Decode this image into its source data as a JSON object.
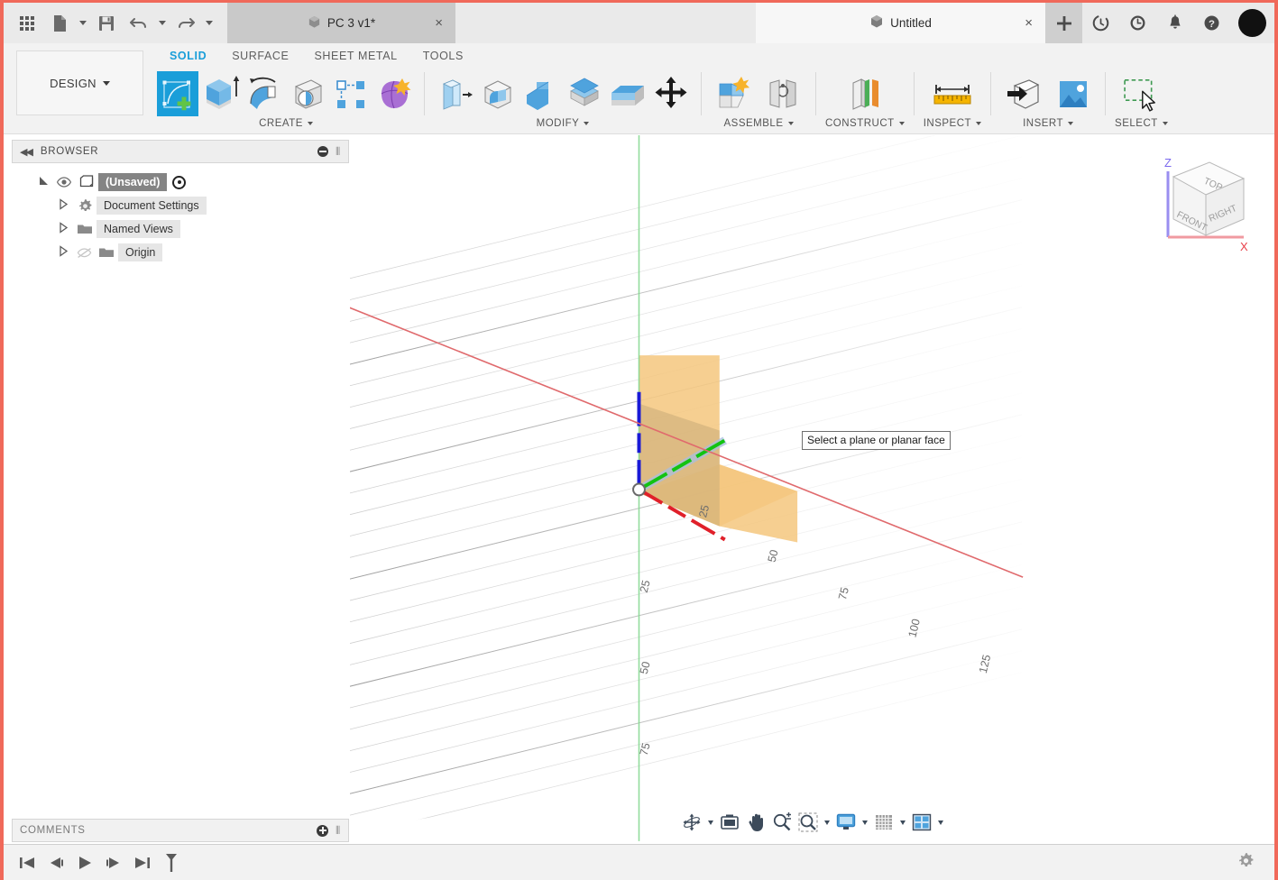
{
  "titlebar": {
    "apps_icon": "grid-apps-icon",
    "new_doc_icon": "new-document-icon",
    "save_icon": "save-icon",
    "undo_icon": "undo-icon",
    "redo_icon": "redo-icon",
    "tabs": [
      {
        "label": "PC 3 v1*",
        "icon": "cube-icon",
        "close": "×",
        "active": false
      },
      {
        "label": "Untitled",
        "icon": "cube-icon",
        "close": "×",
        "active": true
      }
    ],
    "new_tab_label": "+",
    "icons": [
      "job-status-icon",
      "recent-activity-icon",
      "notifications-bell-icon",
      "help-icon",
      "account-avatar"
    ]
  },
  "ribbon": {
    "workspace": "DESIGN",
    "tabs": [
      {
        "label": "SOLID",
        "active": true
      },
      {
        "label": "SURFACE",
        "active": false
      },
      {
        "label": "SHEET METAL",
        "active": false
      },
      {
        "label": "TOOLS",
        "active": false
      }
    ],
    "panels": [
      {
        "label": "CREATE",
        "has_dropdown": true,
        "tools": [
          "create-sketch-icon",
          "extrude-icon",
          "revolve-icon",
          "sweep-icon",
          "pattern-icon",
          "form-icon"
        ]
      },
      {
        "label": "MODIFY",
        "has_dropdown": true,
        "tools": [
          "press-pull-icon",
          "fillet-icon",
          "shell-icon",
          "combine-icon",
          "offset-face-icon",
          "move-copy-icon"
        ]
      },
      {
        "label": "ASSEMBLE",
        "has_dropdown": true,
        "tools": [
          "new-component-icon",
          "joint-icon"
        ]
      },
      {
        "label": "CONSTRUCT",
        "has_dropdown": true,
        "tools": [
          "offset-plane-icon"
        ]
      },
      {
        "label": "INSPECT",
        "has_dropdown": true,
        "tools": [
          "measure-icon"
        ]
      },
      {
        "label": "INSERT",
        "has_dropdown": true,
        "tools": [
          "insert-derive-icon",
          "decal-icon"
        ]
      },
      {
        "label": "SELECT",
        "has_dropdown": true,
        "tools": [
          "window-selection-icon"
        ]
      }
    ]
  },
  "browser": {
    "title": "BROWSER",
    "collapse_icon": "collapse-left-icon",
    "minimize_icon": "minimize-icon",
    "tree": [
      {
        "label": "(Unsaved)",
        "icon": "component-icon",
        "expander": "expanded",
        "has_eye": true,
        "selected": true,
        "has_radio": true,
        "indent": 0
      },
      {
        "label": "Document Settings",
        "icon": "gear-icon",
        "expander": "collapsed",
        "has_eye": false,
        "selected": false,
        "has_radio": false,
        "indent": 1
      },
      {
        "label": "Named Views",
        "icon": "folder-icon",
        "expander": "collapsed",
        "has_eye": false,
        "selected": false,
        "has_radio": false,
        "indent": 1
      },
      {
        "label": "Origin",
        "icon": "folder-icon",
        "expander": "collapsed",
        "has_eye": true,
        "eye_off": true,
        "selected": false,
        "has_radio": false,
        "indent": 1
      }
    ]
  },
  "comments": {
    "title": "COMMENTS",
    "add_icon": "add-comment-icon"
  },
  "viewport": {
    "tooltip": "Select a plane or planar face",
    "origin_label": "origin-point",
    "viewcube": {
      "faces": [
        "TOP",
        "FRONT",
        "RIGHT"
      ],
      "axes": [
        {
          "label": "Z",
          "color": "#7b68ee"
        },
        {
          "label": "X",
          "color": "#e8404a"
        }
      ]
    },
    "grid_labels": {
      "z_axis": [
        "25",
        "50",
        "75"
      ],
      "x_axis": [
        "25",
        "50",
        "75",
        "100",
        "125"
      ]
    },
    "planes": [
      {
        "name": "xz-plane",
        "color": "#f5c77e"
      },
      {
        "name": "xy-plane",
        "color": "#f5c77e"
      }
    ],
    "axis_colors": {
      "x": "#e0202a",
      "y": "#12c312",
      "z": "#1a1ad6"
    },
    "navbar": [
      {
        "icon": "orbit-icon",
        "dropdown": true
      },
      {
        "icon": "look-at-icon",
        "dropdown": false
      },
      {
        "icon": "pan-icon",
        "dropdown": false
      },
      {
        "icon": "zoom-icon",
        "dropdown": false
      },
      {
        "icon": "fit-icon",
        "dropdown": true
      },
      {
        "icon": "display-settings-icon",
        "dropdown": true
      },
      {
        "icon": "grid-snaps-icon",
        "dropdown": true
      },
      {
        "icon": "viewports-icon",
        "dropdown": true
      }
    ]
  },
  "timeline": {
    "buttons": [
      "go-to-beginning-icon",
      "step-back-icon",
      "play-icon",
      "step-forward-icon",
      "go-to-end-icon",
      "timeline-marker-icon"
    ],
    "settings_icon": "gear-icon"
  },
  "colors": {
    "accent": "#1a9ed9",
    "window_border": "#f0695a",
    "selection": "#848484",
    "plane_fill": "#f5c77e"
  }
}
